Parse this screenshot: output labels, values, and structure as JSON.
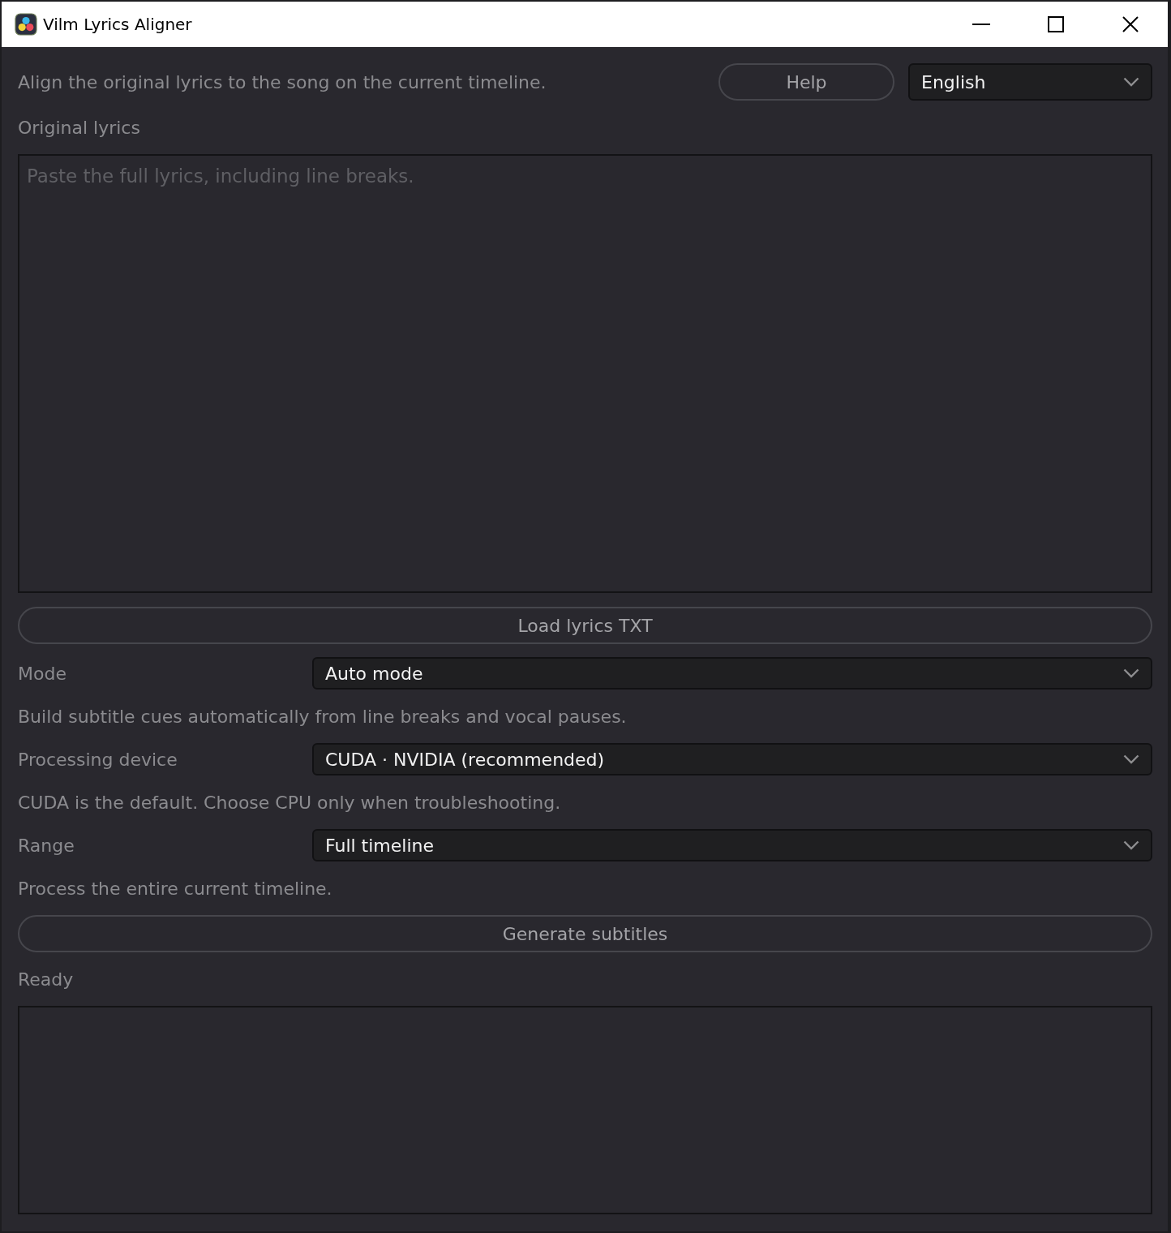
{
  "window": {
    "title": "Vilm Lyrics Aligner"
  },
  "header": {
    "description": "Align the original lyrics to the song on the current timeline.",
    "help_button": "Help",
    "language": {
      "value": "English"
    }
  },
  "lyrics": {
    "label": "Original lyrics",
    "placeholder": "Paste the full lyrics, including line breaks.",
    "load_button": "Load lyrics TXT"
  },
  "settings": [
    {
      "label": "Mode",
      "value": "Auto mode",
      "hint": "Build subtitle cues automatically from line breaks and vocal pauses."
    },
    {
      "label": "Processing device",
      "value": "CUDA · NVIDIA (recommended)",
      "hint": "CUDA is the default. Choose CPU only when troubleshooting."
    },
    {
      "label": "Range",
      "value": "Full timeline",
      "hint": "Process the entire current timeline."
    }
  ],
  "generate_button": "Generate subtitles",
  "status": {
    "text": "Ready"
  }
}
